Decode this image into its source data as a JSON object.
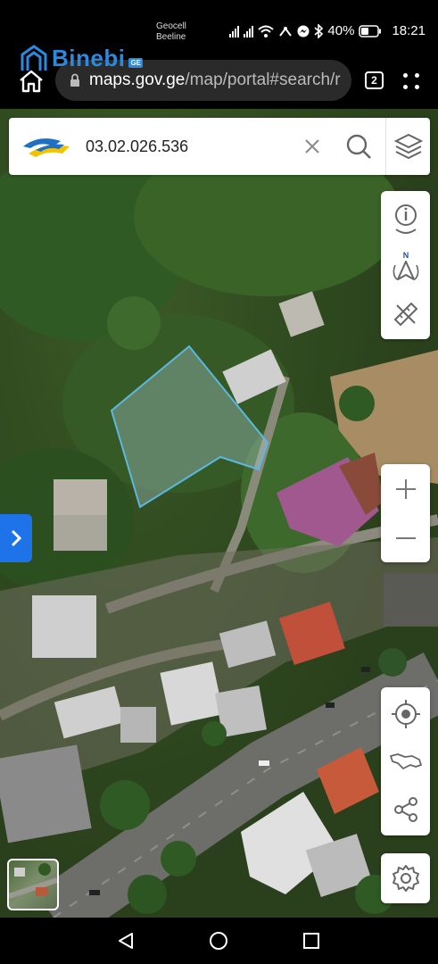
{
  "status_bar": {
    "carrier_1": "Geocell",
    "carrier_2": "Beeline",
    "battery_percent": "40%",
    "time": "18:21"
  },
  "watermark": {
    "brand": "Binebi",
    "brand_suffix": "GE"
  },
  "browser": {
    "url_domain": "maps.gov.ge",
    "url_path": "/map/portal#search/r",
    "tab_count": "2"
  },
  "search": {
    "value": "03.02.026.536",
    "placeholder": ""
  },
  "map_controls": {
    "compass_letter": "N"
  },
  "icons": {
    "home": "home-icon",
    "lock": "lock-icon",
    "tabs": "tabs-icon",
    "menu": "more-vert-icon",
    "clear": "close-icon",
    "search": "search-icon",
    "layers": "layers-icon",
    "info": "info-pin-icon",
    "compass": "compass-icon",
    "measure": "ruler-pencil-icon",
    "zoom_in": "plus-icon",
    "zoom_out": "minus-icon",
    "locate": "crosshair-icon",
    "country": "georgia-map-icon",
    "share": "share-icon",
    "settings": "gear-icon",
    "expand": "chevron-right-icon",
    "nav_back": "triangle-back-icon",
    "nav_home": "circle-home-icon",
    "nav_recent": "square-recents-icon"
  },
  "colors": {
    "accent_blue": "#1e73e8",
    "parcel_outline": "#5bb8e0",
    "logo_blue": "#1f6fc2",
    "logo_yellow": "#f2c400"
  }
}
